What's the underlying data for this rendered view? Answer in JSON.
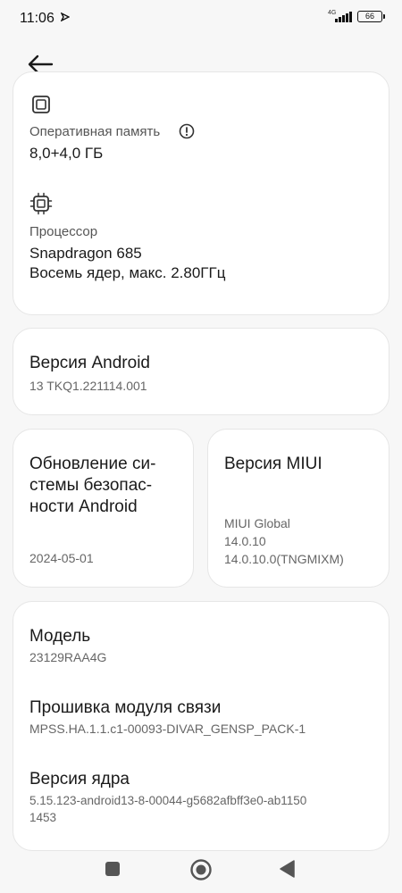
{
  "status_bar": {
    "time": "11:06",
    "network": "4G",
    "battery": "66"
  },
  "memory": {
    "label": "Оперативная память",
    "value": "8,0+4,0 ГБ"
  },
  "processor": {
    "label": "Процессор",
    "name": "Snapdragon 685",
    "detail": "Восемь ядер, макс. 2.80ГГц"
  },
  "android_version": {
    "title": "Версия Android",
    "value": "13 TKQ1.221114.001"
  },
  "security_update": {
    "title_lines": [
      "Обновление си-",
      "стемы безопас-",
      "ности Android"
    ],
    "date": "2024-05-01"
  },
  "miui_version": {
    "title": "Версия MIUI",
    "lines": [
      "MIUI Global",
      "14.0.10",
      "14.0.10.0(TNGMIXM)"
    ]
  },
  "model": {
    "title": "Модель",
    "value": "23129RAA4G"
  },
  "baseband": {
    "title": "Прошивка модуля связи",
    "value": "MPSS.HA.1.1.c1-00093-DIVAR_GENSP_PACK-1"
  },
  "kernel": {
    "title": "Версия ядра",
    "lines": [
      "5.15.123-android13-8-00044-g5682afbff3e0-ab1150",
      "1453"
    ]
  }
}
